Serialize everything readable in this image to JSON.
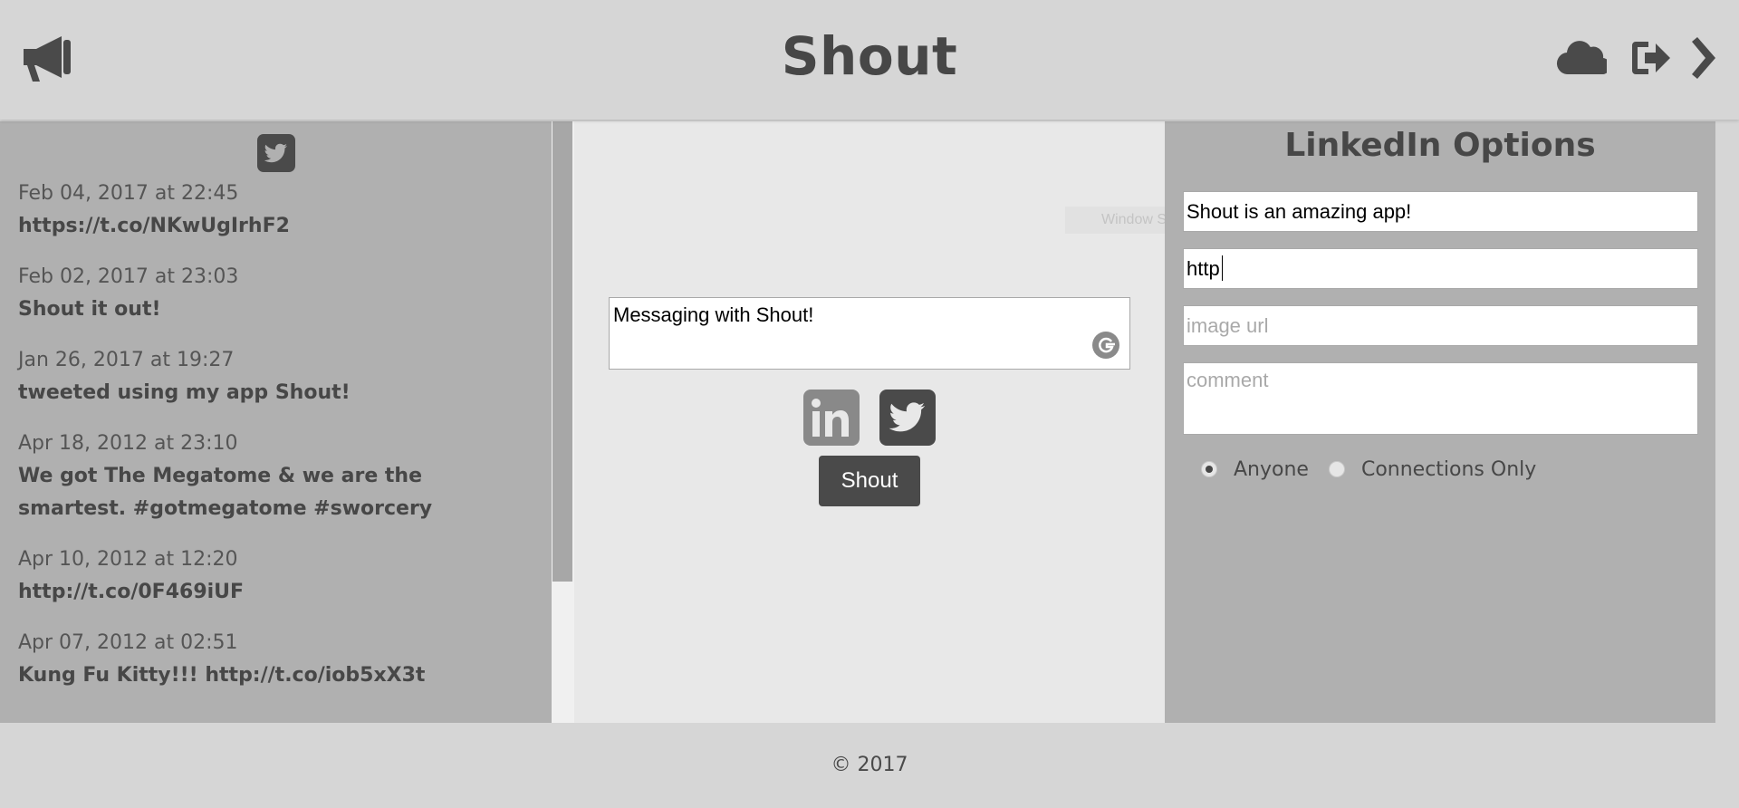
{
  "header": {
    "title": "Shout",
    "brand_icon": "megaphone-icon",
    "buttons": [
      {
        "name": "cloud-icon"
      },
      {
        "name": "sign-out-icon"
      },
      {
        "name": "chevron-right-icon"
      }
    ]
  },
  "feed": {
    "network_icon": "twitter-icon",
    "items": [
      {
        "date": "Feb 04, 2017 at 22:45",
        "text": "https://t.co/NKwUgIrhF2"
      },
      {
        "date": "Feb 02, 2017 at 23:03",
        "text": "Shout it out!"
      },
      {
        "date": "Jan 26, 2017 at 19:27",
        "text": "tweeted using my app Shout!"
      },
      {
        "date": "Apr 18, 2012 at 23:10",
        "text": "We got The Megatome & we are the smartest. #gotmegatome #sworcery"
      },
      {
        "date": "Apr 10, 2012 at 12:20",
        "text": "http://t.co/0F469iUF"
      },
      {
        "date": "Apr 07, 2012 at 02:51",
        "text": "Kung Fu Kitty!!! http://t.co/iob5xX3t"
      }
    ]
  },
  "compose": {
    "message": "Messaging with Shout!",
    "overlay_text": "Window Snip",
    "networks": [
      {
        "name": "linkedin-icon",
        "label": "in"
      },
      {
        "name": "twitter-icon"
      }
    ],
    "shout_label": "Shout"
  },
  "options": {
    "title": "LinkedIn Options",
    "text_value": "Shout is an amazing app!",
    "url_value": "http",
    "image_placeholder": "image url",
    "comment_placeholder": "comment",
    "visibility": [
      {
        "label": "Anyone",
        "checked": true
      },
      {
        "label": "Connections Only",
        "checked": false
      }
    ]
  },
  "footer": {
    "copyright": "© 2017"
  },
  "colors": {
    "header_bg": "#d6d6d6",
    "panel_bg": "#b0b0b0",
    "compose_bg": "#e8e8e8",
    "dark": "#4a4a4a"
  }
}
